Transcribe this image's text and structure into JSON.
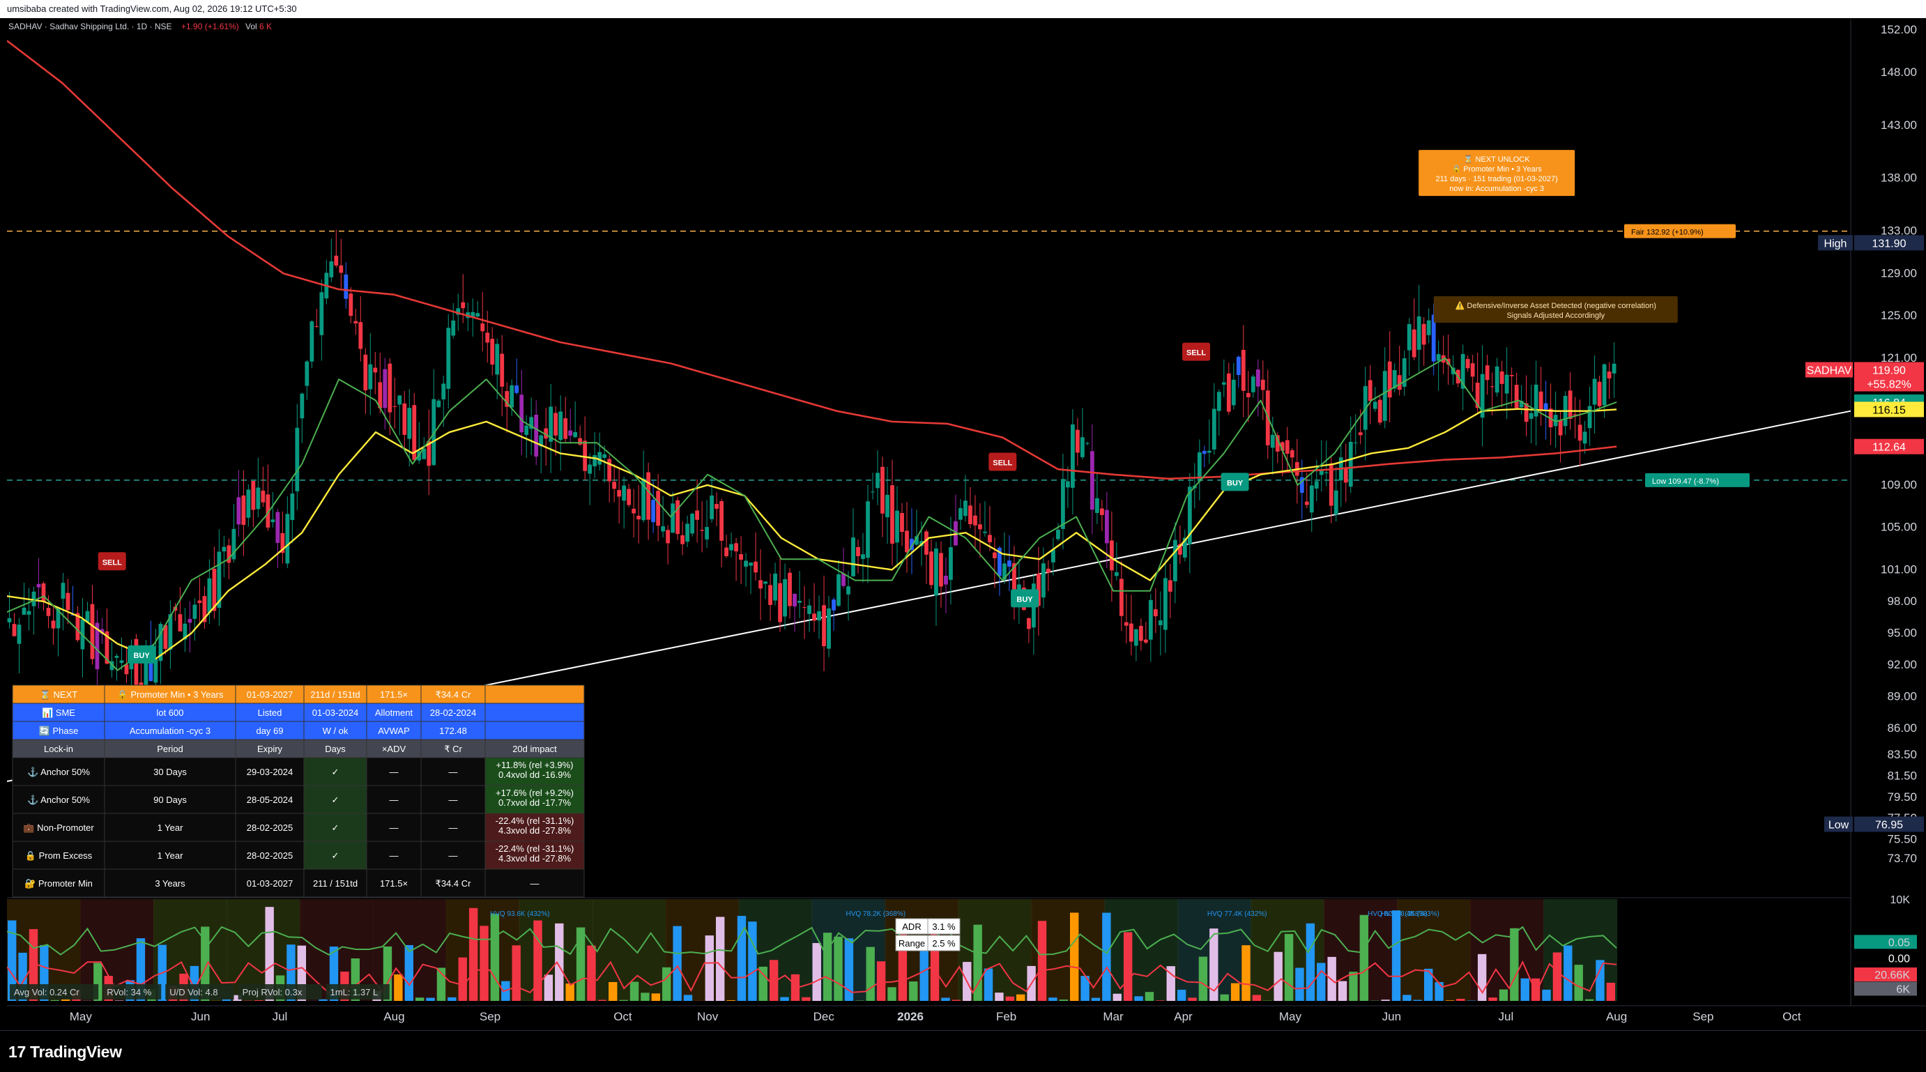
{
  "header": {
    "text": "umsibaba created with TradingView.com, Aug 02, 2026 19:12 UTC+5:30"
  },
  "footer": {
    "brand": "TradingView",
    "brand_mark": "17"
  },
  "chart_data": {
    "type": "candlestick",
    "symbol": "SADHAV",
    "legend": {
      "name": "SADHAV · Sadhav Shipping Ltd. · 1D · NSE",
      "change": "+1.90 (+1.61%)",
      "vol_label": "Vol",
      "vol_value": "6 K"
    },
    "ylim": [
      70,
      153
    ],
    "y_ticks": [
      152,
      148,
      143,
      138,
      133,
      129,
      125,
      121,
      116.84,
      112.64,
      109,
      105,
      101,
      98,
      95,
      92,
      89,
      86,
      83.5,
      81.5,
      79.5,
      77.5,
      75.5,
      73.7
    ],
    "y_tick_labels": [
      "152.00",
      "148.00",
      "143.00",
      "138.00",
      "133.00",
      "129.00",
      "125.00",
      "121.00",
      "",
      "",
      "109.00",
      "105.00",
      "101.00",
      "98.00",
      "95.00",
      "92.00",
      "89.00",
      "86.00",
      "83.50",
      "81.50",
      "79.50",
      "77.50",
      "75.50",
      "73.70"
    ],
    "x_months": [
      {
        "label": "May",
        "x": 0.04
      },
      {
        "label": "Jun",
        "x": 0.105
      },
      {
        "label": "Jul",
        "x": 0.148
      },
      {
        "label": "Aug",
        "x": 0.21
      },
      {
        "label": "Sep",
        "x": 0.262
      },
      {
        "label": "Oct",
        "x": 0.334
      },
      {
        "label": "Nov",
        "x": 0.38
      },
      {
        "label": "Dec",
        "x": 0.443
      },
      {
        "label": "2026",
        "x": 0.49,
        "bold": true
      },
      {
        "label": "Feb",
        "x": 0.542
      },
      {
        "label": "Mar",
        "x": 0.6
      },
      {
        "label": "Apr",
        "x": 0.638
      },
      {
        "label": "May",
        "x": 0.696
      },
      {
        "label": "Jun",
        "x": 0.751
      },
      {
        "label": "Jul",
        "x": 0.813
      },
      {
        "label": "Aug",
        "x": 0.873
      },
      {
        "label": "Sep",
        "x": 0.92
      },
      {
        "label": "Oct",
        "x": 0.968
      }
    ],
    "price_labels": [
      {
        "label": "High",
        "value": "131.90",
        "y": 131.9,
        "bg": "#1e2a4a"
      },
      {
        "label": "SADHAV",
        "value": "119.90",
        "sub": "+55.82%",
        "y": 119.9,
        "bg": "#f23645"
      },
      {
        "label": "",
        "value": "116.84",
        "y": 116.84,
        "bg": "#089981"
      },
      {
        "label": "",
        "value": "116.15",
        "y": 116.15,
        "bg": "#ffeb3b",
        "fg": "#000"
      },
      {
        "label": "",
        "value": "112.64",
        "y": 112.64,
        "bg": "#f23645"
      },
      {
        "label": "Low",
        "value": "76.95",
        "y": 76.95,
        "bg": "#1e2a4a"
      }
    ],
    "hlines": [
      {
        "y": 133.0,
        "color": "#ffb74d",
        "label": "Fair 132.92 (+10.9%)"
      },
      {
        "y": 109.47,
        "color": "#26a69a",
        "label": "Low 109.47 (-8.7%)"
      }
    ],
    "trendline": [
      [
        0.0,
        81.0
      ],
      [
        1.0,
        116.0
      ]
    ],
    "ma_red": [
      [
        0,
        151
      ],
      [
        0.03,
        147
      ],
      [
        0.06,
        142
      ],
      [
        0.09,
        137
      ],
      [
        0.12,
        132.5
      ],
      [
        0.15,
        129
      ],
      [
        0.18,
        127.5
      ],
      [
        0.21,
        127
      ],
      [
        0.24,
        125.5
      ],
      [
        0.27,
        124
      ],
      [
        0.3,
        122.5
      ],
      [
        0.33,
        121.5
      ],
      [
        0.36,
        120.5
      ],
      [
        0.39,
        119
      ],
      [
        0.42,
        117.5
      ],
      [
        0.45,
        116
      ],
      [
        0.48,
        115
      ],
      [
        0.51,
        114.8
      ],
      [
        0.54,
        113.5
      ],
      [
        0.57,
        110.5
      ],
      [
        0.6,
        110
      ],
      [
        0.63,
        109.6
      ],
      [
        0.66,
        109.8
      ],
      [
        0.69,
        110.2
      ],
      [
        0.72,
        110.5
      ],
      [
        0.75,
        111
      ],
      [
        0.78,
        111.4
      ],
      [
        0.81,
        111.6
      ],
      [
        0.84,
        112
      ],
      [
        0.873,
        112.64
      ]
    ],
    "ma_yellow": [
      [
        0,
        98.5
      ],
      [
        0.02,
        98
      ],
      [
        0.04,
        96.5
      ],
      [
        0.06,
        94
      ],
      [
        0.08,
        92.5
      ],
      [
        0.1,
        95
      ],
      [
        0.12,
        99
      ],
      [
        0.14,
        101.5
      ],
      [
        0.16,
        104.5
      ],
      [
        0.18,
        110
      ],
      [
        0.2,
        114
      ],
      [
        0.22,
        112
      ],
      [
        0.24,
        114
      ],
      [
        0.26,
        115
      ],
      [
        0.28,
        113.5
      ],
      [
        0.3,
        112
      ],
      [
        0.32,
        111.5
      ],
      [
        0.34,
        110
      ],
      [
        0.36,
        108
      ],
      [
        0.38,
        109
      ],
      [
        0.4,
        108
      ],
      [
        0.42,
        104
      ],
      [
        0.44,
        102
      ],
      [
        0.46,
        101.5
      ],
      [
        0.48,
        101
      ],
      [
        0.5,
        104
      ],
      [
        0.52,
        104.5
      ],
      [
        0.54,
        102.5
      ],
      [
        0.56,
        102
      ],
      [
        0.58,
        104.5
      ],
      [
        0.6,
        102
      ],
      [
        0.62,
        100
      ],
      [
        0.64,
        104
      ],
      [
        0.66,
        108.5
      ],
      [
        0.68,
        110
      ],
      [
        0.7,
        110.5
      ],
      [
        0.72,
        111
      ],
      [
        0.74,
        112
      ],
      [
        0.76,
        112.5
      ],
      [
        0.78,
        114
      ],
      [
        0.8,
        116
      ],
      [
        0.82,
        116.2
      ],
      [
        0.84,
        116
      ],
      [
        0.86,
        116
      ],
      [
        0.873,
        116.15
      ]
    ],
    "ma_green": [
      [
        0,
        97
      ],
      [
        0.02,
        98.5
      ],
      [
        0.04,
        95
      ],
      [
        0.06,
        91.5
      ],
      [
        0.08,
        94
      ],
      [
        0.1,
        100
      ],
      [
        0.12,
        102
      ],
      [
        0.14,
        106
      ],
      [
        0.16,
        111
      ],
      [
        0.18,
        119
      ],
      [
        0.2,
        117
      ],
      [
        0.22,
        111
      ],
      [
        0.24,
        116
      ],
      [
        0.26,
        119
      ],
      [
        0.28,
        115
      ],
      [
        0.3,
        113
      ],
      [
        0.32,
        113
      ],
      [
        0.34,
        110
      ],
      [
        0.36,
        106
      ],
      [
        0.38,
        110
      ],
      [
        0.4,
        108
      ],
      [
        0.42,
        102
      ],
      [
        0.44,
        102
      ],
      [
        0.46,
        100
      ],
      [
        0.48,
        100
      ],
      [
        0.5,
        106
      ],
      [
        0.52,
        104
      ],
      [
        0.54,
        100
      ],
      [
        0.56,
        104
      ],
      [
        0.58,
        106
      ],
      [
        0.6,
        99
      ],
      [
        0.62,
        99
      ],
      [
        0.64,
        108
      ],
      [
        0.66,
        112
      ],
      [
        0.68,
        117
      ],
      [
        0.7,
        109
      ],
      [
        0.72,
        112
      ],
      [
        0.74,
        117
      ],
      [
        0.76,
        119
      ],
      [
        0.78,
        121
      ],
      [
        0.8,
        116
      ],
      [
        0.82,
        117
      ],
      [
        0.84,
        115
      ],
      [
        0.86,
        116
      ],
      [
        0.873,
        116.84
      ]
    ],
    "candles_seed": 1531,
    "candles_anchor": [
      [
        0,
        97
      ],
      [
        0.03,
        98
      ],
      [
        0.05,
        93
      ],
      [
        0.07,
        91
      ],
      [
        0.09,
        95
      ],
      [
        0.11,
        99
      ],
      [
        0.13,
        108
      ],
      [
        0.15,
        103
      ],
      [
        0.165,
        126
      ],
      [
        0.18,
        130
      ],
      [
        0.19,
        120
      ],
      [
        0.21,
        117
      ],
      [
        0.225,
        111
      ],
      [
        0.24,
        124
      ],
      [
        0.255,
        127
      ],
      [
        0.27,
        118
      ],
      [
        0.285,
        114
      ],
      [
        0.3,
        114
      ],
      [
        0.32,
        112
      ],
      [
        0.34,
        108
      ],
      [
        0.36,
        105
      ],
      [
        0.38,
        106
      ],
      [
        0.395,
        100
      ],
      [
        0.42,
        98
      ],
      [
        0.44,
        95
      ],
      [
        0.455,
        101
      ],
      [
        0.47,
        108
      ],
      [
        0.49,
        103
      ],
      [
        0.5,
        100
      ],
      [
        0.52,
        106
      ],
      [
        0.54,
        102
      ],
      [
        0.555,
        97
      ],
      [
        0.57,
        108
      ],
      [
        0.58,
        115
      ],
      [
        0.6,
        99
      ],
      [
        0.615,
        94
      ],
      [
        0.63,
        101
      ],
      [
        0.65,
        114
      ],
      [
        0.665,
        119
      ],
      [
        0.68,
        116
      ],
      [
        0.7,
        109
      ],
      [
        0.72,
        108
      ],
      [
        0.735,
        116
      ],
      [
        0.75,
        118
      ],
      [
        0.765,
        125
      ],
      [
        0.78,
        121
      ],
      [
        0.795,
        118
      ],
      [
        0.81,
        119
      ],
      [
        0.83,
        116
      ],
      [
        0.85,
        115
      ],
      [
        0.873,
        119.9
      ]
    ],
    "signals": [
      {
        "type": "SELL",
        "x": 0.057,
        "y": 101.8
      },
      {
        "type": "BUY",
        "x": 0.073,
        "y": 93.0
      },
      {
        "type": "SELL",
        "x": 0.54,
        "y": 111.2
      },
      {
        "type": "BUY",
        "x": 0.552,
        "y": 98.3
      },
      {
        "type": "SELL",
        "x": 0.645,
        "y": 121.6
      },
      {
        "type": "BUY",
        "x": 0.666,
        "y": 109.3
      }
    ],
    "annotations": [
      {
        "name": "next-unlock-box",
        "lines": [
          "⌛ NEXT UNLOCK",
          "🔒 Promoter Min • 3 Years",
          "211 days · 151 trading  (01-03-2027)",
          "now in: Accumulation -cyc 3"
        ],
        "x": 0.808,
        "y": 138.5,
        "color": "#f7931a"
      },
      {
        "name": "defensive-box",
        "lines": [
          "⚠️ Defensive/Inverse Asset Detected (negative correlation)",
          "Signals Adjusted Accordingly"
        ],
        "x": 0.84,
        "y": 125.6,
        "color": "#4a2e00"
      }
    ],
    "oscillator": {
      "labels": [
        {
          "text": "HVQ 93.6K (432%)",
          "x": 0.262
        },
        {
          "text": "HVQ 78.2K (368%)",
          "x": 0.455
        },
        {
          "text": "HVQ 77.4K (432%)",
          "x": 0.651
        },
        {
          "text": "HVY 98.4K (383%)",
          "x": 0.745
        },
        {
          "text": "HVQ 82.2K (358%)",
          "x": 0.738
        }
      ],
      "stats_box": [
        {
          "k": "ADR",
          "v": "3.1 %"
        },
        {
          "k": "Range",
          "v": "2.5 %"
        }
      ],
      "bottom_strip": [
        {
          "k": "Avg Vol",
          "v": "0.24 Cr"
        },
        {
          "k": "RVol",
          "v": "34 %"
        },
        {
          "k": "U/D Vol",
          "v": "4.8"
        },
        {
          "k": "Proj RVol",
          "v": "0.3x"
        },
        {
          "k": "1mL",
          "v": "1.37 L"
        }
      ],
      "axis_labels": [
        {
          "text": "10K",
          "y": 0.0
        },
        {
          "text": "0.05",
          "y": 0.42,
          "bg": "#089981"
        },
        {
          "text": "0.00",
          "y": 0.58,
          "fg": "#fff",
          "bg": "#000"
        },
        {
          "text": "20.66K",
          "y": 0.74,
          "bg": "#f23645"
        },
        {
          "text": "6K",
          "y": 0.88,
          "bg": "#5d606b"
        }
      ],
      "seed": 9187
    },
    "table": {
      "rows_top": [
        {
          "c": [
            "⌛ NEXT",
            "🔒 Promoter Min • 3 Years",
            "01-03-2027",
            "211d / 151td",
            "171.5×",
            "₹34.4 Cr",
            ""
          ],
          "bg": "#f7931a"
        },
        {
          "c": [
            "📊 SME",
            "lot 600",
            "Listed",
            "01-03-2024",
            "Allotment",
            "28-02-2024",
            ""
          ],
          "bg": "#2962ff"
        },
        {
          "c": [
            "🔄 Phase",
            "Accumulation -cyc 3",
            "day 69",
            "W / ok",
            "AVWAP",
            "172.48",
            ""
          ],
          "bg": "#2962ff"
        }
      ],
      "head": [
        "Lock-in",
        "Period",
        "Expiry",
        "Days",
        "×ADV",
        "₹ Cr",
        "20d impact"
      ],
      "rows": [
        {
          "c": [
            "⚓ Anchor 50%",
            "30 Days",
            "29-03-2024",
            "✓",
            "—",
            "—",
            "+11.8%  (rel +3.9%)|0.4xvol  dd -16.9%"
          ],
          "impact": "pos"
        },
        {
          "c": [
            "⚓ Anchor 50%",
            "90 Days",
            "28-05-2024",
            "✓",
            "—",
            "—",
            "+17.6%  (rel +9.2%)|0.7xvol  dd -17.7%"
          ],
          "impact": "pos"
        },
        {
          "c": [
            "💼 Non-Promoter",
            "1 Year",
            "28-02-2025",
            "✓",
            "—",
            "—",
            "-22.4%  (rel -31.1%)|4.3xvol  dd -27.8%"
          ],
          "impact": "neg"
        },
        {
          "c": [
            "🔒 Prom Excess",
            "1 Year",
            "28-02-2025",
            "✓",
            "—",
            "—",
            "-22.4%  (rel -31.1%)|4.3xvol  dd -27.8%"
          ],
          "impact": "neg"
        },
        {
          "c": [
            "🔐 Promoter Min",
            "3 Years",
            "01-03-2027",
            "211 / 151td",
            "171.5×",
            "₹34.4 Cr",
            "—"
          ],
          "impact": "none"
        }
      ]
    }
  }
}
